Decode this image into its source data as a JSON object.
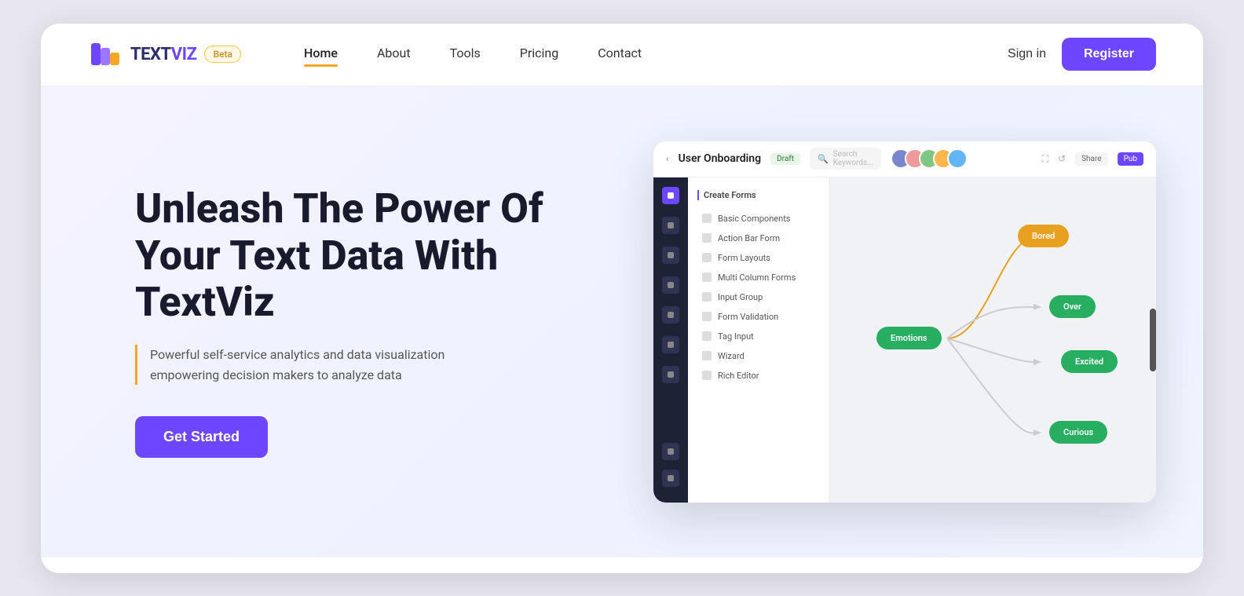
{
  "brand": {
    "logo_text_dark": "TEXT",
    "logo_text_purple": "VIZ",
    "beta_label": "Beta"
  },
  "nav": {
    "links": [
      {
        "label": "Home",
        "active": true
      },
      {
        "label": "About",
        "active": false
      },
      {
        "label": "Tools",
        "active": false
      },
      {
        "label": "Pricing",
        "active": false
      },
      {
        "label": "Contact",
        "active": false
      }
    ],
    "sign_in": "Sign in",
    "register": "Register"
  },
  "hero": {
    "title": "Unleash The Power Of Your Text Data With TextViz",
    "subtitle": "Powerful self-service analytics and data visualization empowering decision makers to analyze data",
    "cta": "Get Started"
  },
  "mockup": {
    "title": "User Onboarding",
    "draft_badge": "Draft",
    "search_placeholder": "Search Keywords...",
    "share_label": "Share",
    "publish_label": "Pub",
    "panel": {
      "section_title": "Create Forms",
      "items": [
        "Basic Components",
        "Action Bar Form",
        "Form Layouts",
        "Multi Column Forms",
        "Input Group",
        "Form Validation",
        "Tag Input",
        "Wizard",
        "Rich Editor"
      ]
    },
    "nodes": [
      {
        "label": "Bored",
        "color": "#e8a020"
      },
      {
        "label": "Emotions",
        "color": "#27ae60"
      },
      {
        "label": "Over",
        "color": "#27ae60"
      },
      {
        "label": "Excited",
        "color": "#27ae60"
      },
      {
        "label": "Curious",
        "color": "#27ae60"
      }
    ]
  }
}
